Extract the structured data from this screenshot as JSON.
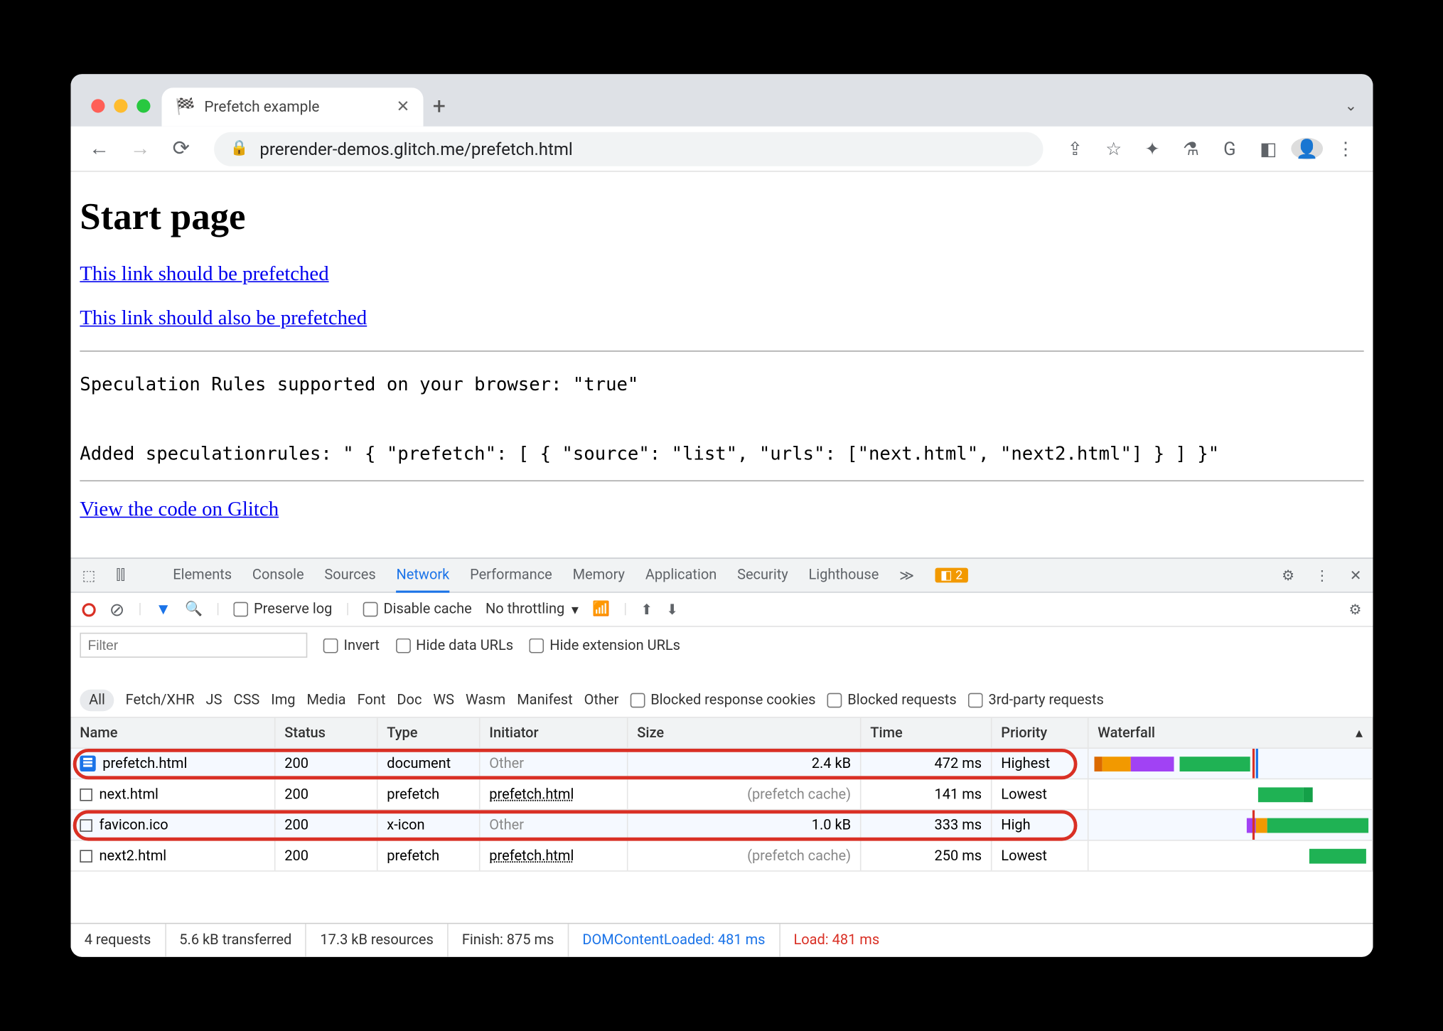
{
  "browser": {
    "tab_title": "Prefetch example",
    "url": "prerender-demos.glitch.me/prefetch.html"
  },
  "page": {
    "heading": "Start page",
    "link1": "This link should be prefetched",
    "link2": "This link should also be prefetched",
    "spec_line1": "Speculation Rules supported on your browser: \"true\"",
    "spec_line2": "Added speculationrules: \" { \"prefetch\": [ { \"source\": \"list\", \"urls\": [\"next.html\", \"next2.html\"] } ] }\"",
    "glitch_link": "View the code on Glitch"
  },
  "devtools": {
    "tabs": [
      "Elements",
      "Console",
      "Sources",
      "Network",
      "Performance",
      "Memory",
      "Application",
      "Security",
      "Lighthouse"
    ],
    "active_tab": "Network",
    "issues_count": "2",
    "toolbar": {
      "preserve_log": "Preserve log",
      "disable_cache": "Disable cache",
      "throttling": "No throttling"
    },
    "filter": {
      "placeholder": "Filter",
      "invert": "Invert",
      "hide_data": "Hide data URLs",
      "hide_ext": "Hide extension URLs",
      "types": [
        "All",
        "Fetch/XHR",
        "JS",
        "CSS",
        "Img",
        "Media",
        "Font",
        "Doc",
        "WS",
        "Wasm",
        "Manifest",
        "Other"
      ],
      "blocked_cookies": "Blocked response cookies",
      "blocked_req": "Blocked requests",
      "third_party": "3rd-party requests"
    },
    "columns": [
      "Name",
      "Status",
      "Type",
      "Initiator",
      "Size",
      "Time",
      "Priority",
      "Waterfall"
    ],
    "rows": [
      {
        "name": "prefetch.html",
        "status": "200",
        "type": "document",
        "initiator": "Other",
        "initiator_muted": true,
        "size": "2.4 kB",
        "time": "472 ms",
        "priority": "Highest",
        "doc": true
      },
      {
        "name": "next.html",
        "status": "200",
        "type": "prefetch",
        "initiator": "prefetch.html",
        "initiator_muted": false,
        "size": "(prefetch cache)",
        "size_muted": true,
        "time": "141 ms",
        "priority": "Lowest",
        "doc": false
      },
      {
        "name": "favicon.ico",
        "status": "200",
        "type": "x-icon",
        "initiator": "Other",
        "initiator_muted": true,
        "size": "1.0 kB",
        "time": "333 ms",
        "priority": "High",
        "doc": false
      },
      {
        "name": "next2.html",
        "status": "200",
        "type": "prefetch",
        "initiator": "prefetch.html",
        "initiator_muted": false,
        "size": "(prefetch cache)",
        "size_muted": true,
        "time": "250 ms",
        "priority": "Lowest",
        "doc": false
      }
    ],
    "summary": {
      "requests": "4 requests",
      "transferred": "5.6 kB transferred",
      "resources": "17.3 kB resources",
      "finish": "Finish: 875 ms",
      "dcl": "DOMContentLoaded: 481 ms",
      "load": "Load: 481 ms"
    }
  }
}
